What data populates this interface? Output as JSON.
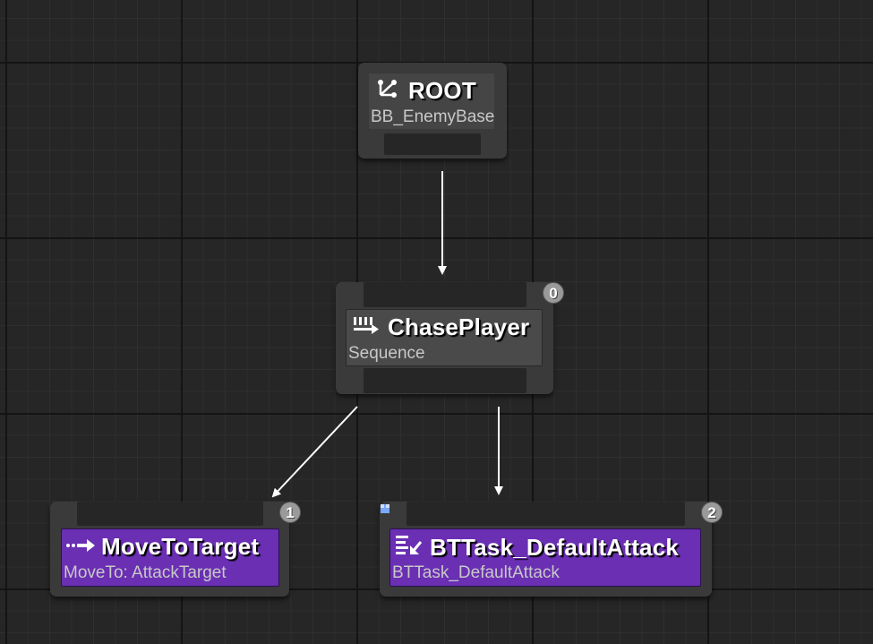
{
  "graph": {
    "root": {
      "title": "ROOT",
      "subtitle": "BB_EnemyBase",
      "icon": "tree-branch-icon"
    },
    "sequence": {
      "title": "ChasePlayer",
      "subtitle": "Sequence",
      "icon": "sequence-icon",
      "execution_index": "0"
    },
    "move_task": {
      "title": "MoveToTarget",
      "subtitle": "MoveTo: AttackTarget",
      "icon": "move-to-icon",
      "execution_index": "1"
    },
    "attack_task": {
      "title": "BTTask_DefaultAttack",
      "subtitle": "BTTask_DefaultAttack",
      "icon": "task-icon",
      "execution_index": "2"
    }
  },
  "colors": {
    "background": "#262626",
    "node_body": "#3a3a3a",
    "composite_title": "#4a4a4a",
    "task_title": "#6a2fb3",
    "wire": "#ffffff",
    "badge": "#9a9a9a",
    "service_marker": "#7aa7ff"
  }
}
